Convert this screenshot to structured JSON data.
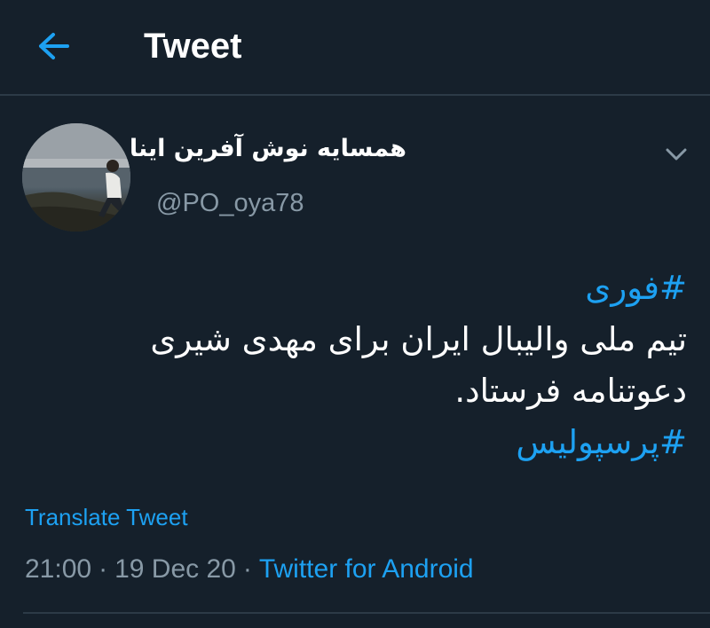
{
  "header": {
    "title": "Tweet",
    "back_icon": "arrow-left-icon"
  },
  "colors": {
    "background": "#15202b",
    "accent": "#1da1f2",
    "secondary_text": "#8899a6",
    "divider": "#2c3a47"
  },
  "tweet": {
    "author": {
      "display_name": "همسایه نوش آفرین اینا",
      "handle": "@PO_oya78"
    },
    "more_icon": "chevron-down-icon",
    "lines": [
      {
        "text": "#فوری",
        "hashtag": true
      },
      {
        "text": "تیم ملی والیبال ایران برای مهدی شیری",
        "hashtag": false
      },
      {
        "text": "دعوتنامه فرستاد.",
        "hashtag": false
      },
      {
        "text": "#پرسپولیس",
        "hashtag": true
      }
    ],
    "translate_label": "Translate Tweet",
    "time": "21:00",
    "separator": "·",
    "date": "19 Dec 20",
    "source": "Twitter for Android"
  }
}
